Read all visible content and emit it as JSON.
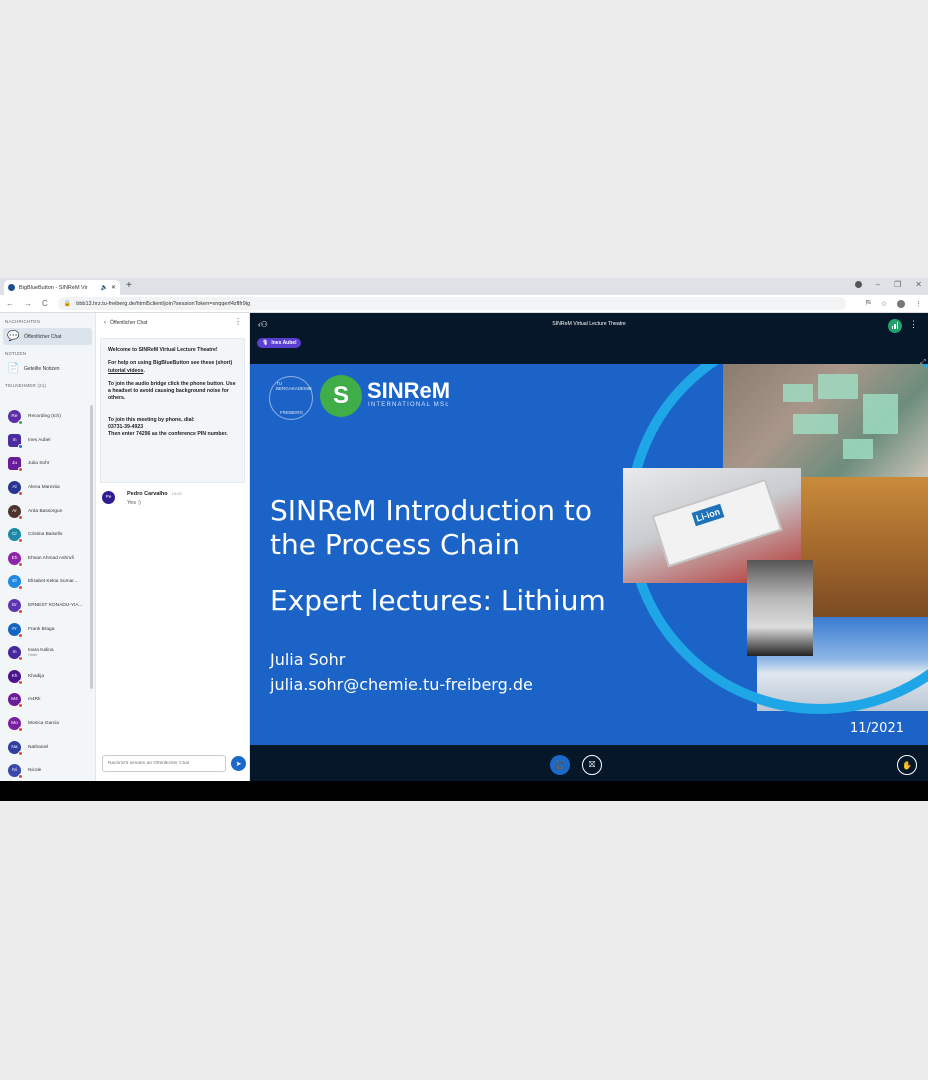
{
  "browser": {
    "tab_title": "BigBlueButton - SINReM Vir",
    "speaker_icon": "🔈",
    "close_glyph": "✕",
    "new_tab_glyph": "+",
    "url": "bbb13.hrz.tu-freiberg.de/html5client/join?sessionToken=xnqqerf4zflfr9ig"
  },
  "sidebar": {
    "messages_header": "NACHRICHTEN",
    "public_chat_label": "Öffentlicher Chat",
    "notes_header": "NOTIZEN",
    "shared_notes_label": "Geteilte Notizen",
    "participants_header": "TEILNEHMER (21)",
    "users": [
      {
        "initials": "Re",
        "name": "Recording (Ich)",
        "color": "#5b2ea6",
        "status": "green",
        "square": false
      },
      {
        "initials": "In",
        "name": "Ines Aubel",
        "color": "#4b2c9e",
        "status": "blue",
        "square": true
      },
      {
        "initials": "Ju",
        "name": "Julia Sohr",
        "color": "#6a1b9a",
        "status": "red",
        "square": true
      },
      {
        "initials": "Al",
        "name": "Alena Mareziia",
        "color": "#283593",
        "status": "red",
        "square": false
      },
      {
        "initials": "Ar",
        "name": "Arda Bassorgun",
        "color": "#4e342e",
        "status": "red",
        "square": false
      },
      {
        "initials": "Cr",
        "name": "Cristina Baisello",
        "color": "#1e88a8",
        "status": "red",
        "square": false
      },
      {
        "initials": "Eh",
        "name": "Ehsan Ahmad Ashrufi",
        "color": "#8e24aa",
        "status": "red",
        "square": false
      },
      {
        "initials": "El",
        "name": "Elisabet Kekia Sumar...",
        "color": "#1e88e5",
        "status": "red",
        "square": false
      },
      {
        "initials": "Er",
        "name": "ERNEST KONADU-YIA...",
        "color": "#5e35b1",
        "status": "red",
        "square": false
      },
      {
        "initials": "Fr",
        "name": "Frank Braga",
        "color": "#1565c0",
        "status": "red",
        "square": false
      },
      {
        "initials": "In",
        "name": "Inara Kalina",
        "subtitle": "Hotel",
        "color": "#4527a0",
        "status": "red",
        "square": false
      },
      {
        "initials": "Kh",
        "name": "Khadija",
        "color": "#4a148c",
        "status": "red",
        "square": false
      },
      {
        "initials": "M4",
        "name": "m4Rk",
        "color": "#6a1b9a",
        "status": "red",
        "square": false
      },
      {
        "initials": "Mo",
        "name": "Monica Garcia",
        "color": "#7b1fa2",
        "status": "red",
        "square": false
      },
      {
        "initials": "Na",
        "name": "Nathaniel",
        "color": "#303f9f",
        "status": "red",
        "square": false
      },
      {
        "initials": "Ni",
        "name": "Nicole",
        "color": "#3949ab",
        "status": "red",
        "square": false
      }
    ]
  },
  "chat": {
    "header": "Öffentlicher Chat",
    "welcome_title": "Welcome to SINReM Virtual Lecture Theatre!",
    "help_prefix": "For help on using BigBlueButton see these (short) ",
    "help_link": "tutorial videos",
    "help_suffix": ".",
    "audio_help": "To join the audio bridge click the phone button. Use a headset to avoid causing background noise for others.",
    "phone_line1": "To join this meeting by phone, dial:",
    "phone_number": "03731-39-4923",
    "phone_line2": "Then enter 74296 as the conference PIN number.",
    "message_initials": "Pe",
    "message_author": "Pedro Carvalho",
    "message_time": "15:00",
    "message_text": "Yes :)",
    "input_placeholder": "Nachricht senden an Öffentlicher Chat"
  },
  "stage": {
    "title": "SINReM Virtual Lecture Theatre",
    "talking_user": "Ines Aubel"
  },
  "slide": {
    "seal_top": "TU BERGAKADEMIE",
    "seal_bottom": "FREIBERG",
    "logo_text": "SINReM",
    "logo_sub": "INTERNATIONAL MSc",
    "title_line1": "SINReM Introduction to",
    "title_line2": "the Process Chain",
    "subtitle": "Expert lectures: Lithium",
    "author": "Julia Sohr",
    "email": "julia.sohr@chemie.tu-freiberg.de",
    "date": "11/2021",
    "battery_label": "Li-ion"
  },
  "colors": {
    "slide_blue": "#1b63c6",
    "ring_cyan": "#1ea6e6",
    "stage_bg": "#06172a",
    "accent": "#1b6ac9",
    "logo_green": "#3fae49"
  }
}
